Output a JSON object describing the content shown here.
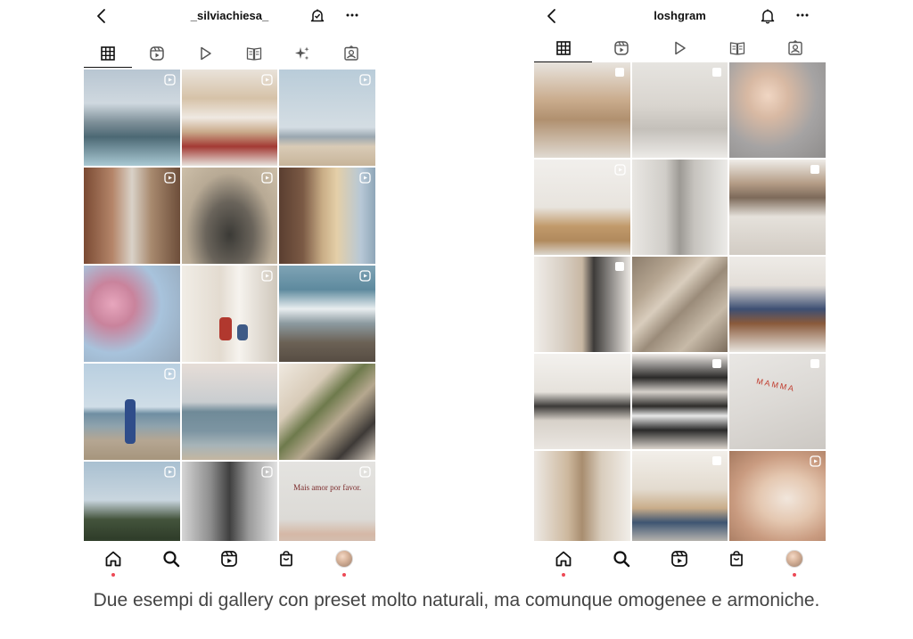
{
  "left_profile": {
    "username": "_silviachiesa_",
    "tabs": [
      {
        "icon": "grid-icon",
        "active": true
      },
      {
        "icon": "reels-icon",
        "active": false
      },
      {
        "icon": "play-icon",
        "active": false
      },
      {
        "icon": "guide-icon",
        "active": false
      },
      {
        "icon": "sparkles-icon",
        "active": false
      },
      {
        "icon": "tagged-icon",
        "active": false
      }
    ],
    "posts": [
      {
        "subject": "infinity pool with sea view",
        "type": "reel"
      },
      {
        "subject": "hotel bedroom with wooden beams",
        "type": "reel"
      },
      {
        "subject": "palm trees on beach",
        "type": "reel"
      },
      {
        "subject": "narrow old town street",
        "type": "reel"
      },
      {
        "subject": "stone arch street",
        "type": "reel"
      },
      {
        "subject": "church facade",
        "type": "reel"
      },
      {
        "subject": "magnolia blossoms",
        "type": "photo"
      },
      {
        "subject": "children by curtain window",
        "type": "reel"
      },
      {
        "subject": "sea waves on rocks",
        "type": "reel"
      },
      {
        "subject": "child on beach",
        "type": "reel"
      },
      {
        "subject": "sea horizon",
        "type": "photo"
      },
      {
        "subject": "kitchen with plants",
        "type": "photo"
      },
      {
        "subject": "palm tree and sky",
        "type": "reel"
      },
      {
        "subject": "mirror selfie with baby",
        "type": "reel"
      },
      {
        "subject": "note card",
        "type": "reel",
        "text": "Mais amor por favor."
      }
    ]
  },
  "right_profile": {
    "username": "loshgram",
    "tabs": [
      {
        "icon": "grid-icon",
        "active": true
      },
      {
        "icon": "reels-icon",
        "active": false
      },
      {
        "icon": "play-icon",
        "active": false
      },
      {
        "icon": "guide-icon",
        "active": false
      },
      {
        "icon": "tagged-icon",
        "active": false
      }
    ],
    "posts": [
      {
        "subject": "two toddlers",
        "type": "carousel"
      },
      {
        "subject": "bathroom mirror",
        "type": "carousel"
      },
      {
        "subject": "woman in grey sweater",
        "type": "photo"
      },
      {
        "subject": "dining table with mug",
        "type": "reel"
      },
      {
        "subject": "mirror selfie grey outfit",
        "type": "photo"
      },
      {
        "subject": "table with branches",
        "type": "carousel"
      },
      {
        "subject": "woman in beige coat",
        "type": "carousel"
      },
      {
        "subject": "sunlight on floor",
        "type": "photo"
      },
      {
        "subject": "child in cowboy costume",
        "type": "photo"
      },
      {
        "subject": "living room",
        "type": "photo"
      },
      {
        "subject": "child pirate costume",
        "type": "carousel"
      },
      {
        "subject": "handwritten note",
        "type": "carousel",
        "text": "MAMMA"
      },
      {
        "subject": "woman with sunglasses",
        "type": "photo"
      },
      {
        "subject": "child at play table",
        "type": "carousel"
      },
      {
        "subject": "face mask skincare",
        "type": "reel"
      }
    ]
  },
  "bottom_nav": [
    {
      "icon": "home-icon",
      "dot": true
    },
    {
      "icon": "search-icon",
      "dot": false
    },
    {
      "icon": "reels-icon",
      "dot": false
    },
    {
      "icon": "shop-icon",
      "dot": false
    },
    {
      "icon": "profile-avatar",
      "dot": true
    }
  ],
  "caption": "Due esempi di gallery con preset molto naturali, ma comunque omogenee e armoniche.",
  "colors": {
    "accent_dot": "#ed4956",
    "text": "#111111",
    "caption": "#444444"
  }
}
